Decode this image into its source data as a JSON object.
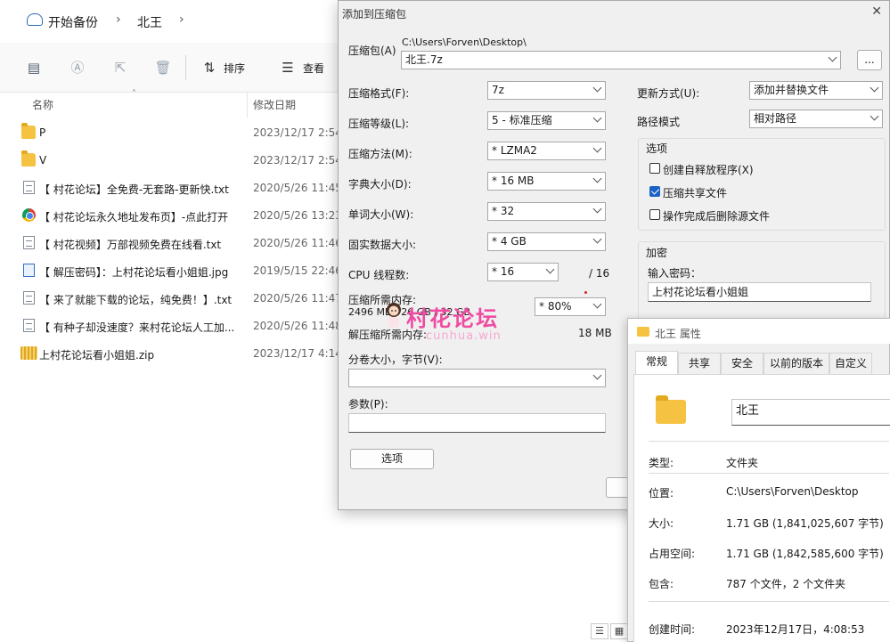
{
  "explorer": {
    "breadcrumb": [
      "开始备份",
      "北王"
    ],
    "toolbar": {
      "sort_label": "排序",
      "view_label": "查看"
    },
    "columns": {
      "name": "名称",
      "date": "修改日期"
    },
    "files": [
      {
        "name": "P",
        "date": "2023/12/17 2:54",
        "type": "folder"
      },
      {
        "name": "V",
        "date": "2023/12/17 2:54",
        "type": "folder"
      },
      {
        "name": "【 村花论坛】全免费-无套路-更新快.txt",
        "date": "2020/5/26 11:45",
        "type": "txt"
      },
      {
        "name": "【 村花论坛永久地址发布页】-点此打开",
        "date": "2020/5/26 13:23",
        "type": "chrome"
      },
      {
        "name": "【 村花视频】万部视频免费在线看.txt",
        "date": "2020/5/26 11:46",
        "type": "txt"
      },
      {
        "name": "【 解压密码】：上村花论坛看小姐姐.jpg",
        "date": "2019/5/15 22:46",
        "type": "jpg"
      },
      {
        "name": "【 来了就能下载的论坛，纯免费！】.txt",
        "date": "2020/5/26 11:47",
        "type": "txt"
      },
      {
        "name": "【 有种子却没速度？来村花论坛人工加...",
        "date": "2020/5/26 11:48",
        "type": "txt"
      },
      {
        "name": "上村花论坛看小姐姐.zip",
        "date": "2023/12/17 4:14",
        "type": "zip"
      }
    ]
  },
  "archive_dialog": {
    "title": "添加到压缩包",
    "archive_label": "压缩包(A)",
    "archive_path": "C:\\Users\\Forven\\Desktop\\",
    "archive_name": "北王.7z",
    "browse_label": "...",
    "format_label": "压缩格式(F):",
    "format_value": "7z",
    "level_label": "压缩等级(L):",
    "level_value": "5 - 标准压缩",
    "method_label": "压缩方法(M):",
    "method_value": "* LZMA2",
    "dict_label": "字典大小(D):",
    "dict_value": "* 16 MB",
    "word_label": "单词大小(W):",
    "word_value": "* 32",
    "solid_label": "固实数据大小:",
    "solid_value": "* 4 GB",
    "threads_label": "CPU 线程数:",
    "threads_value": "* 16",
    "threads_max": "/ 16",
    "mem_comp_label": "压缩所需内存:",
    "mem_comp_detail": "2496 MB / 26 GB / 32 GB",
    "mem_percent": "* 80%",
    "mem_decomp_label": "解压缩所需内存:",
    "mem_decomp_value": "18 MB",
    "split_label": "分卷大小，字节(V):",
    "params_label": "参数(P):",
    "options_button": "选项",
    "update_label": "更新方式(U):",
    "update_value": "添加并替换文件",
    "path_mode_label": "路径模式",
    "path_mode_value": "相对路径",
    "options_group": "选项",
    "opt_sfx": "创建自释放程序(X)",
    "opt_shared": "压缩共享文件",
    "opt_delete": "操作完成后删除源文件",
    "opt_sfx_checked": false,
    "opt_shared_checked": true,
    "opt_delete_checked": false,
    "encrypt_group": "加密",
    "password_label": "输入密码：",
    "password_value": "上村花论坛看小姐姐"
  },
  "watermark": {
    "text": "村花论坛",
    "url": "cunhua.win"
  },
  "properties": {
    "title": "北王 属性",
    "tabs": [
      "常规",
      "共享",
      "安全",
      "以前的版本",
      "自定义"
    ],
    "active_tab": "常规",
    "folder_name": "北王",
    "type_label": "类型:",
    "type_value": "文件夹",
    "location_label": "位置:",
    "location_value": "C:\\Users\\Forven\\Desktop",
    "size_label": "大小:",
    "size_value": "1.71 GB (1,841,025,607 字节)",
    "disk_label": "占用空间:",
    "disk_value": "1.71 GB (1,842,585,600 字节)",
    "contains_label": "包含:",
    "contains_value": "787 个文件，2 个文件夹",
    "created_label": "创建时间:",
    "created_value": "2023年12月17日，4:08:53"
  }
}
